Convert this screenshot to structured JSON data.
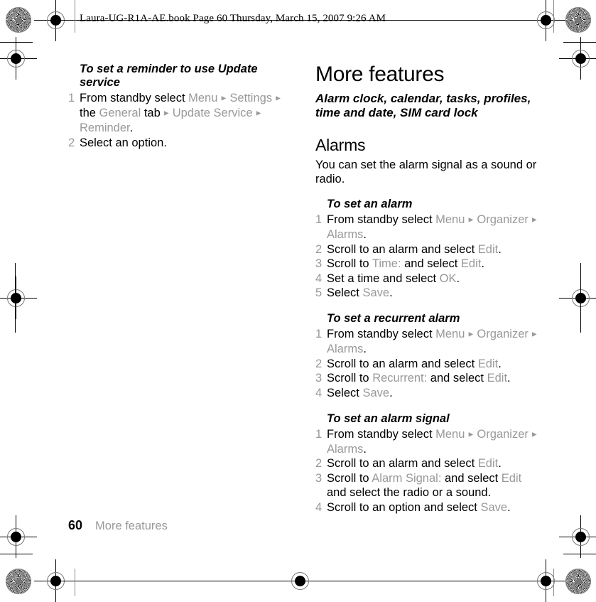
{
  "header": {
    "slug": "Laura-UG-R1A-AE.book  Page 60  Thursday, March 15, 2007  9:26 AM"
  },
  "colors": {
    "ui_element_gray": "#999999",
    "body_black": "#000000",
    "page_background": "#ffffff"
  },
  "left_column": {
    "procedure_title": "To set a reminder to use Update service",
    "steps": [
      {
        "num": "1",
        "parts": [
          {
            "text": "From standby select ",
            "style": "normal"
          },
          {
            "text": "Menu",
            "style": "ui"
          },
          {
            "text": " ► ",
            "style": "tri"
          },
          {
            "text": "Settings",
            "style": "ui"
          },
          {
            "text": " ► ",
            "style": "tri"
          },
          {
            "text": "the ",
            "style": "normal"
          },
          {
            "text": "General",
            "style": "ui"
          },
          {
            "text": " tab",
            "style": "normal"
          },
          {
            "text": " ► ",
            "style": "tri"
          },
          {
            "text": "Update Service",
            "style": "ui"
          },
          {
            "text": " ► ",
            "style": "tri"
          },
          {
            "text": "Reminder",
            "style": "ui"
          },
          {
            "text": ".",
            "style": "normal"
          }
        ]
      },
      {
        "num": "2",
        "parts": [
          {
            "text": "Select an option.",
            "style": "normal"
          }
        ]
      }
    ]
  },
  "right_column": {
    "chapter_title": "More features",
    "chapter_subtitle": "Alarm clock, calendar, tasks, profiles, time and date, SIM card lock",
    "section_title": "Alarms",
    "section_intro": "You can set the alarm signal as a sound or radio.",
    "procedures": [
      {
        "title": "To set an alarm",
        "steps": [
          {
            "num": "1",
            "parts": [
              {
                "text": "From standby select ",
                "style": "normal"
              },
              {
                "text": "Menu",
                "style": "ui"
              },
              {
                "text": " ► ",
                "style": "tri"
              },
              {
                "text": "Organizer",
                "style": "ui"
              },
              {
                "text": " ► ",
                "style": "tri"
              },
              {
                "text": "Alarms",
                "style": "ui"
              },
              {
                "text": ".",
                "style": "normal"
              }
            ]
          },
          {
            "num": "2",
            "parts": [
              {
                "text": "Scroll to an alarm and select ",
                "style": "normal"
              },
              {
                "text": "Edit",
                "style": "ui"
              },
              {
                "text": ".",
                "style": "normal"
              }
            ]
          },
          {
            "num": "3",
            "parts": [
              {
                "text": "Scroll to ",
                "style": "normal"
              },
              {
                "text": "Time:",
                "style": "ui"
              },
              {
                "text": " and select ",
                "style": "normal"
              },
              {
                "text": "Edit",
                "style": "ui"
              },
              {
                "text": ".",
                "style": "normal"
              }
            ]
          },
          {
            "num": "4",
            "parts": [
              {
                "text": "Set a time and select ",
                "style": "normal"
              },
              {
                "text": "OK",
                "style": "ui"
              },
              {
                "text": ".",
                "style": "normal"
              }
            ]
          },
          {
            "num": "5",
            "parts": [
              {
                "text": "Select ",
                "style": "normal"
              },
              {
                "text": "Save",
                "style": "ui"
              },
              {
                "text": ".",
                "style": "normal"
              }
            ]
          }
        ]
      },
      {
        "title": "To set a recurrent alarm",
        "steps": [
          {
            "num": "1",
            "parts": [
              {
                "text": "From standby select ",
                "style": "normal"
              },
              {
                "text": "Menu",
                "style": "ui"
              },
              {
                "text": " ► ",
                "style": "tri"
              },
              {
                "text": "Organizer",
                "style": "ui"
              },
              {
                "text": " ► ",
                "style": "tri"
              },
              {
                "text": "Alarms",
                "style": "ui"
              },
              {
                "text": ".",
                "style": "normal"
              }
            ]
          },
          {
            "num": "2",
            "parts": [
              {
                "text": "Scroll to an alarm and select ",
                "style": "normal"
              },
              {
                "text": "Edit",
                "style": "ui"
              },
              {
                "text": ".",
                "style": "normal"
              }
            ]
          },
          {
            "num": "3",
            "parts": [
              {
                "text": "Scroll to ",
                "style": "normal"
              },
              {
                "text": "Recurrent:",
                "style": "ui"
              },
              {
                "text": " and select ",
                "style": "normal"
              },
              {
                "text": "Edit",
                "style": "ui"
              },
              {
                "text": ".",
                "style": "normal"
              }
            ]
          },
          {
            "num": "4",
            "parts": [
              {
                "text": "Select ",
                "style": "normal"
              },
              {
                "text": "Save",
                "style": "ui"
              },
              {
                "text": ".",
                "style": "normal"
              }
            ]
          }
        ]
      },
      {
        "title": "To set an alarm signal",
        "steps": [
          {
            "num": "1",
            "parts": [
              {
                "text": "From standby select ",
                "style": "normal"
              },
              {
                "text": "Menu",
                "style": "ui"
              },
              {
                "text": " ► ",
                "style": "tri"
              },
              {
                "text": "Organizer",
                "style": "ui"
              },
              {
                "text": " ► ",
                "style": "tri"
              },
              {
                "text": "Alarms",
                "style": "ui"
              },
              {
                "text": ".",
                "style": "normal"
              }
            ]
          },
          {
            "num": "2",
            "parts": [
              {
                "text": "Scroll to an alarm and select ",
                "style": "normal"
              },
              {
                "text": "Edit",
                "style": "ui"
              },
              {
                "text": ".",
                "style": "normal"
              }
            ]
          },
          {
            "num": "3",
            "parts": [
              {
                "text": "Scroll to ",
                "style": "normal"
              },
              {
                "text": "Alarm Signal:",
                "style": "ui"
              },
              {
                "text": " and select ",
                "style": "normal"
              },
              {
                "text": "Edit",
                "style": "ui"
              },
              {
                "text": " and select the radio or a sound.",
                "style": "normal"
              }
            ]
          },
          {
            "num": "4",
            "parts": [
              {
                "text": "Scroll to an option and select ",
                "style": "normal"
              },
              {
                "text": "Save",
                "style": "ui"
              },
              {
                "text": ".",
                "style": "normal"
              }
            ]
          }
        ]
      }
    ]
  },
  "footer": {
    "page_number": "60",
    "chapter_name": "More features"
  }
}
